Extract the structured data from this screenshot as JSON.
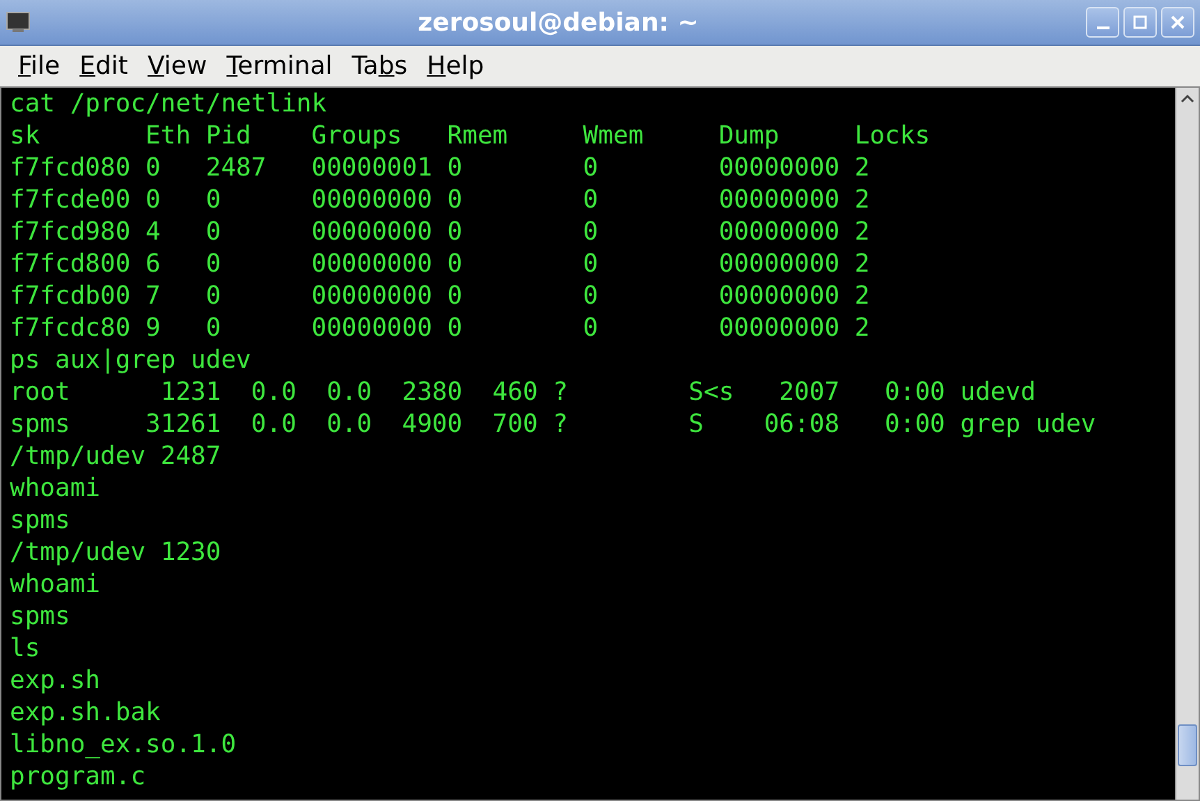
{
  "window": {
    "title": "zerosoul@debian: ~"
  },
  "menu": [
    {
      "key": "F",
      "after": "ile"
    },
    {
      "key": "E",
      "after": "dit"
    },
    {
      "key": "V",
      "after": "iew"
    },
    {
      "key": "T",
      "after": "erminal"
    },
    {
      "before": "Ta",
      "key": "b",
      "after": "s"
    },
    {
      "key": "H",
      "after": "elp"
    }
  ],
  "terminal": {
    "lines": [
      "cat /proc/net/netlink",
      "sk       Eth Pid    Groups   Rmem     Wmem     Dump     Locks",
      "f7fcd080 0   2487   00000001 0        0        00000000 2",
      "f7fcde00 0   0      00000000 0        0        00000000 2",
      "f7fcd980 4   0      00000000 0        0        00000000 2",
      "f7fcd800 6   0      00000000 0        0        00000000 2",
      "f7fcdb00 7   0      00000000 0        0        00000000 2",
      "f7fcdc80 9   0      00000000 0        0        00000000 2",
      "ps aux|grep udev",
      "root      1231  0.0  0.0  2380  460 ?        S<s   2007   0:00 udevd",
      "spms     31261  0.0  0.0  4900  700 ?        S    06:08   0:00 grep udev",
      "/tmp/udev 2487",
      "whoami",
      "spms",
      "/tmp/udev 1230",
      "whoami",
      "spms",
      "ls",
      "exp.sh",
      "exp.sh.bak",
      "libno_ex.so.1.0",
      "program.c"
    ]
  }
}
